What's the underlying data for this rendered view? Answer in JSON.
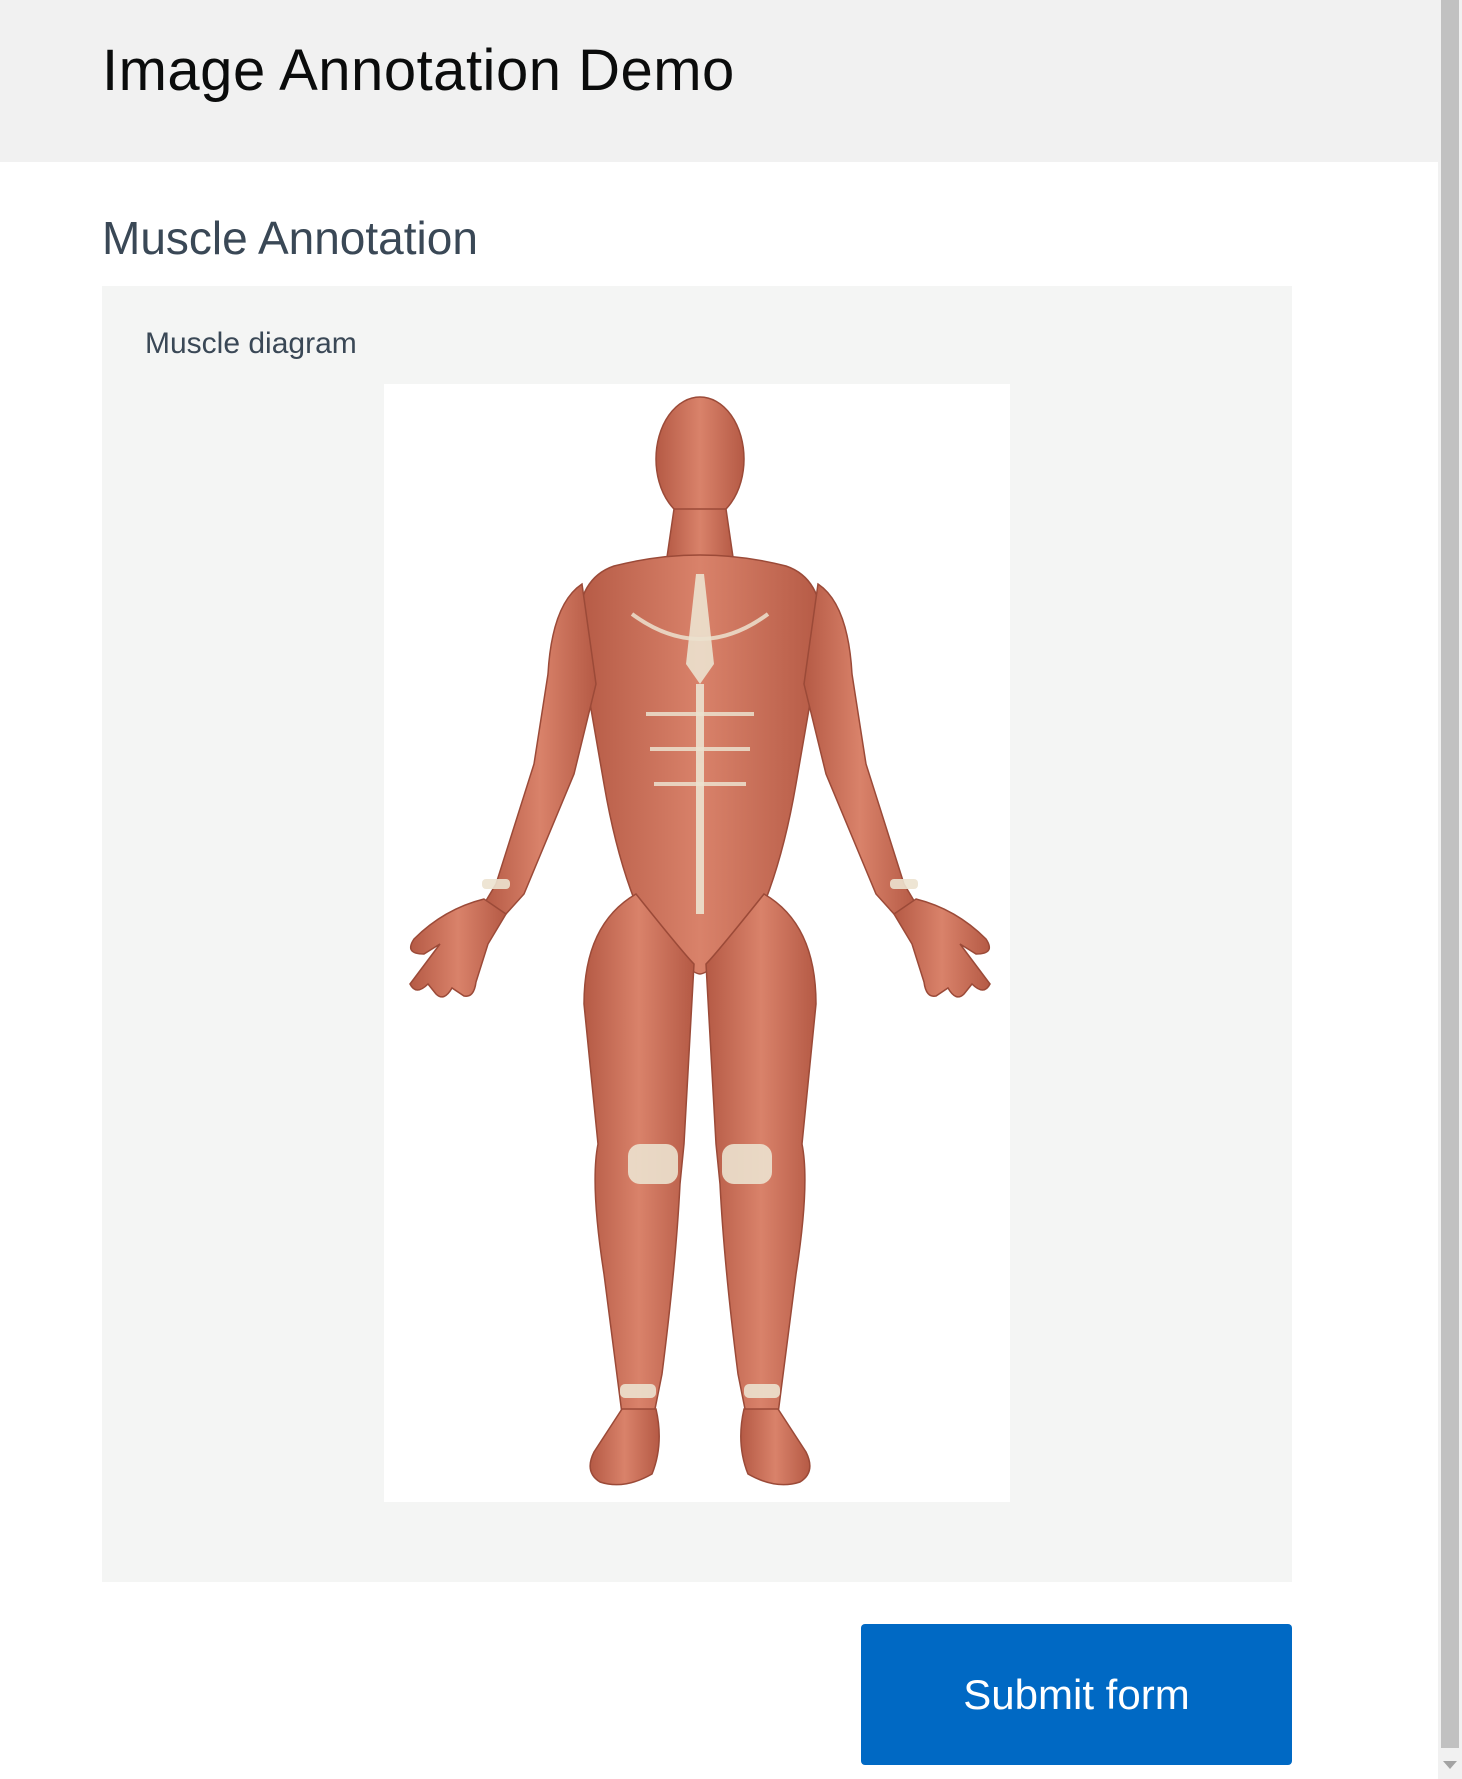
{
  "header": {
    "title": "Image Annotation Demo"
  },
  "section": {
    "title": "Muscle Annotation"
  },
  "panel": {
    "label": "Muscle diagram"
  },
  "form": {
    "submit_label": "Submit form"
  },
  "colors": {
    "header_bg": "#f1f1f1",
    "panel_bg": "#f4f5f4",
    "button_bg": "#0069c4",
    "muscle": "#c9705a",
    "tendon": "#ece2cf"
  }
}
